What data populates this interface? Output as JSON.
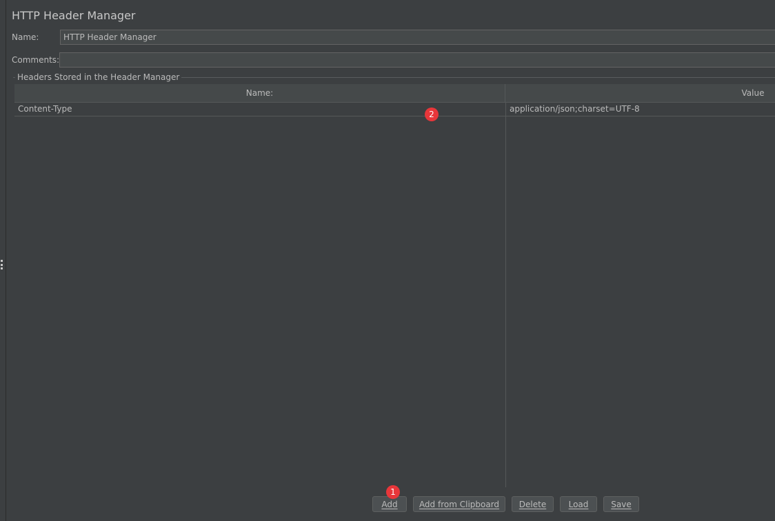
{
  "panel": {
    "title": "HTTP Header Manager"
  },
  "form": {
    "name_label": "Name:",
    "name_value": "HTTP Header Manager",
    "comments_label": "Comments:",
    "comments_value": ""
  },
  "headers_group": {
    "title": "Headers Stored in the Header Manager",
    "columns": [
      "Name:",
      "Value"
    ],
    "rows": [
      {
        "name": "Content-Type",
        "value": "application/json;charset=UTF-8"
      }
    ]
  },
  "buttons": {
    "add": "Add",
    "add_from_clipboard": "Add from Clipboard",
    "delete": "Delete",
    "load": "Load",
    "save": "Save"
  },
  "annotations": {
    "badge_1": "1",
    "badge_2": "2",
    "badge_color": "#e8363a"
  }
}
